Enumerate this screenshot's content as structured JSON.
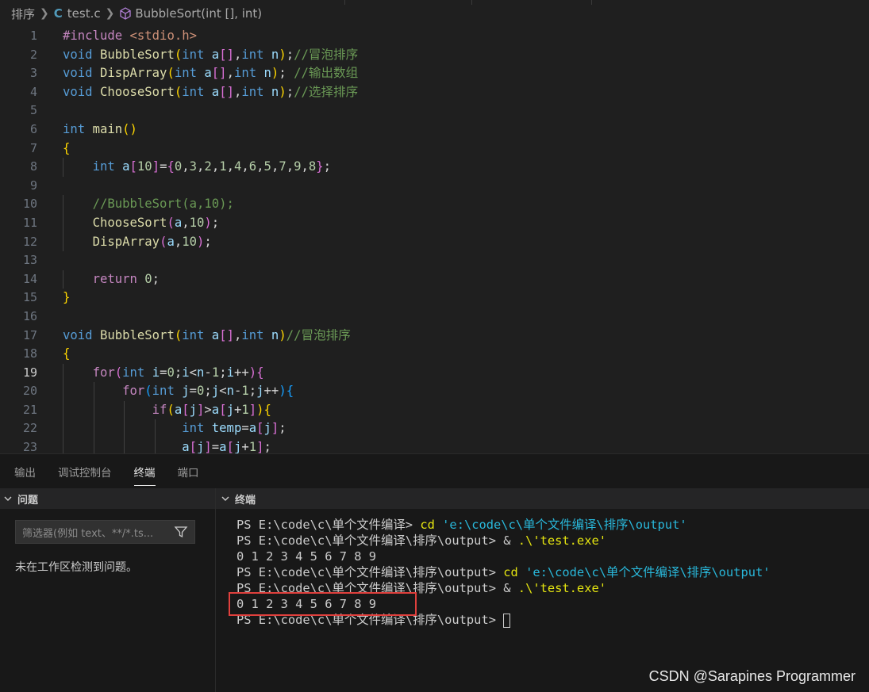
{
  "breadcrumb": {
    "folder": "排序",
    "file_icon": "C",
    "file": "test.c",
    "symbol": "BubbleSort(int [], int)"
  },
  "editor": {
    "active_line": 19,
    "line_numbers": [
      "1",
      "2",
      "3",
      "4",
      "5",
      "6",
      "7",
      "8",
      "9",
      "10",
      "11",
      "12",
      "13",
      "14",
      "15",
      "16",
      "17",
      "18",
      "19",
      "20",
      "21",
      "22",
      "23"
    ],
    "lines": [
      [
        [
          "#include ",
          "pre"
        ],
        [
          "<stdio.h>",
          "str"
        ]
      ],
      [
        [
          "void ",
          "type"
        ],
        [
          "BubbleSort",
          "fn"
        ],
        [
          "(",
          "p1"
        ],
        [
          "int ",
          "type"
        ],
        [
          "a",
          "id"
        ],
        [
          "[]",
          "p2"
        ],
        [
          ",",
          "txt"
        ],
        [
          "int ",
          "type"
        ],
        [
          "n",
          "id"
        ],
        [
          ")",
          "p1"
        ],
        [
          ";",
          "txt"
        ],
        [
          "//冒泡排序",
          "cm"
        ]
      ],
      [
        [
          "void ",
          "type"
        ],
        [
          "DispArray",
          "fn"
        ],
        [
          "(",
          "p1"
        ],
        [
          "int ",
          "type"
        ],
        [
          "a",
          "id"
        ],
        [
          "[]",
          "p2"
        ],
        [
          ",",
          "txt"
        ],
        [
          "int ",
          "type"
        ],
        [
          "n",
          "id"
        ],
        [
          ")",
          "p1"
        ],
        [
          "; ",
          "txt"
        ],
        [
          "//输出数组",
          "cm"
        ]
      ],
      [
        [
          "void ",
          "type"
        ],
        [
          "ChooseSort",
          "fn"
        ],
        [
          "(",
          "p1"
        ],
        [
          "int ",
          "type"
        ],
        [
          "a",
          "id"
        ],
        [
          "[]",
          "p2"
        ],
        [
          ",",
          "txt"
        ],
        [
          "int ",
          "type"
        ],
        [
          "n",
          "id"
        ],
        [
          ")",
          "p1"
        ],
        [
          ";",
          "txt"
        ],
        [
          "//选择排序",
          "cm"
        ]
      ],
      [],
      [
        [
          "int ",
          "type"
        ],
        [
          "main",
          "fn"
        ],
        [
          "()",
          "p1"
        ]
      ],
      [
        [
          "{",
          "p1"
        ]
      ],
      [
        [
          "    ",
          "txt"
        ],
        [
          "int ",
          "type"
        ],
        [
          "a",
          "id"
        ],
        [
          "[",
          "p2"
        ],
        [
          "10",
          "num"
        ],
        [
          "]",
          "p2"
        ],
        [
          "=",
          "txt"
        ],
        [
          "{",
          "p2"
        ],
        [
          "0",
          "num"
        ],
        [
          ",",
          "txt"
        ],
        [
          "3",
          "num"
        ],
        [
          ",",
          "txt"
        ],
        [
          "2",
          "num"
        ],
        [
          ",",
          "txt"
        ],
        [
          "1",
          "num"
        ],
        [
          ",",
          "txt"
        ],
        [
          "4",
          "num"
        ],
        [
          ",",
          "txt"
        ],
        [
          "6",
          "num"
        ],
        [
          ",",
          "txt"
        ],
        [
          "5",
          "num"
        ],
        [
          ",",
          "txt"
        ],
        [
          "7",
          "num"
        ],
        [
          ",",
          "txt"
        ],
        [
          "9",
          "num"
        ],
        [
          ",",
          "txt"
        ],
        [
          "8",
          "num"
        ],
        [
          "}",
          "p2"
        ],
        [
          ";",
          "txt"
        ]
      ],
      [],
      [
        [
          "    ",
          "txt"
        ],
        [
          "//BubbleSort(a,10);",
          "cm"
        ]
      ],
      [
        [
          "    ",
          "txt"
        ],
        [
          "ChooseSort",
          "fn"
        ],
        [
          "(",
          "p2"
        ],
        [
          "a",
          "id"
        ],
        [
          ",",
          "txt"
        ],
        [
          "10",
          "num"
        ],
        [
          ")",
          "p2"
        ],
        [
          ";",
          "txt"
        ]
      ],
      [
        [
          "    ",
          "txt"
        ],
        [
          "DispArray",
          "fn"
        ],
        [
          "(",
          "p2"
        ],
        [
          "a",
          "id"
        ],
        [
          ",",
          "txt"
        ],
        [
          "10",
          "num"
        ],
        [
          ")",
          "p2"
        ],
        [
          ";",
          "txt"
        ]
      ],
      [],
      [
        [
          "    ",
          "txt"
        ],
        [
          "return ",
          "ctl"
        ],
        [
          "0",
          "num"
        ],
        [
          ";",
          "txt"
        ]
      ],
      [
        [
          "}",
          "p1"
        ]
      ],
      [],
      [
        [
          "void ",
          "type"
        ],
        [
          "BubbleSort",
          "fn"
        ],
        [
          "(",
          "p1"
        ],
        [
          "int ",
          "type"
        ],
        [
          "a",
          "id"
        ],
        [
          "[]",
          "p2"
        ],
        [
          ",",
          "txt"
        ],
        [
          "int ",
          "type"
        ],
        [
          "n",
          "id"
        ],
        [
          ")",
          "p1"
        ],
        [
          "//冒泡排序",
          "cm"
        ]
      ],
      [
        [
          "{",
          "p1"
        ]
      ],
      [
        [
          "    ",
          "txt"
        ],
        [
          "for",
          "ctl"
        ],
        [
          "(",
          "p2"
        ],
        [
          "int ",
          "type"
        ],
        [
          "i",
          "id"
        ],
        [
          "=",
          "txt"
        ],
        [
          "0",
          "num"
        ],
        [
          ";",
          "txt"
        ],
        [
          "i",
          "id"
        ],
        [
          "<",
          "txt"
        ],
        [
          "n",
          "id"
        ],
        [
          "-",
          "txt"
        ],
        [
          "1",
          "num"
        ],
        [
          ";",
          "txt"
        ],
        [
          "i",
          "id"
        ],
        [
          "++",
          "txt"
        ],
        [
          ")",
          "p2"
        ],
        [
          "{",
          "p2"
        ]
      ],
      [
        [
          "        ",
          "txt"
        ],
        [
          "for",
          "ctl"
        ],
        [
          "(",
          "p3"
        ],
        [
          "int ",
          "type"
        ],
        [
          "j",
          "id"
        ],
        [
          "=",
          "txt"
        ],
        [
          "0",
          "num"
        ],
        [
          ";",
          "txt"
        ],
        [
          "j",
          "id"
        ],
        [
          "<",
          "txt"
        ],
        [
          "n",
          "id"
        ],
        [
          "-",
          "txt"
        ],
        [
          "1",
          "num"
        ],
        [
          ";",
          "txt"
        ],
        [
          "j",
          "id"
        ],
        [
          "++",
          "txt"
        ],
        [
          ")",
          "p3"
        ],
        [
          "{",
          "p3"
        ]
      ],
      [
        [
          "            ",
          "txt"
        ],
        [
          "if",
          "ctl"
        ],
        [
          "(",
          "p1"
        ],
        [
          "a",
          "id"
        ],
        [
          "[",
          "p2"
        ],
        [
          "j",
          "id"
        ],
        [
          "]",
          "p2"
        ],
        [
          ">",
          "txt"
        ],
        [
          "a",
          "id"
        ],
        [
          "[",
          "p2"
        ],
        [
          "j",
          "id"
        ],
        [
          "+",
          "txt"
        ],
        [
          "1",
          "num"
        ],
        [
          "]",
          "p2"
        ],
        [
          ")",
          "p1"
        ],
        [
          "{",
          "p1"
        ]
      ],
      [
        [
          "                ",
          "txt"
        ],
        [
          "int ",
          "type"
        ],
        [
          "temp",
          "id"
        ],
        [
          "=",
          "txt"
        ],
        [
          "a",
          "id"
        ],
        [
          "[",
          "p2"
        ],
        [
          "j",
          "id"
        ],
        [
          "]",
          "p2"
        ],
        [
          ";",
          "txt"
        ]
      ],
      [
        [
          "                ",
          "txt"
        ],
        [
          "a",
          "id"
        ],
        [
          "[",
          "p2"
        ],
        [
          "j",
          "id"
        ],
        [
          "]",
          "p2"
        ],
        [
          "=",
          "txt"
        ],
        [
          "a",
          "id"
        ],
        [
          "[",
          "p2"
        ],
        [
          "j",
          "id"
        ],
        [
          "+",
          "txt"
        ],
        [
          "1",
          "num"
        ],
        [
          "]",
          "p2"
        ],
        [
          ";",
          "txt"
        ]
      ]
    ]
  },
  "panel": {
    "tabs": [
      {
        "label": "输出",
        "active": false
      },
      {
        "label": "调试控制台",
        "active": false
      },
      {
        "label": "终端",
        "active": true
      },
      {
        "label": "端口",
        "active": false
      }
    ]
  },
  "problems": {
    "header": "问题",
    "filter_placeholder": "筛选器(例如 text、**/*.ts...",
    "empty_message": "未在工作区检测到问题。"
  },
  "terminal": {
    "header": "终端",
    "lines": [
      [
        [
          "PS E:\\code\\c\\单个文件编译> ",
          "txt"
        ],
        [
          "cd ",
          "cmd"
        ],
        [
          "'e:\\code\\c\\单个文件编译\\排序\\output'",
          "str"
        ]
      ],
      [
        [
          "PS E:\\code\\c\\单个文件编译\\排序\\output> ",
          "txt"
        ],
        [
          "& ",
          "txt"
        ],
        [
          ".\\'test.exe'",
          "cmd"
        ]
      ],
      [
        [
          "0 1 2 3 4 5 6 7 8 9",
          "txt"
        ]
      ],
      [
        [
          "PS E:\\code\\c\\单个文件编译\\排序\\output> ",
          "txt"
        ],
        [
          "cd ",
          "cmd"
        ],
        [
          "'e:\\code\\c\\单个文件编译\\排序\\output'",
          "str"
        ]
      ],
      [
        [
          "PS E:\\code\\c\\单个文件编译\\排序\\output> ",
          "txt"
        ],
        [
          "& ",
          "txt"
        ],
        [
          ".\\'test.exe'",
          "cmd"
        ]
      ],
      [
        [
          "0 1 2 3 4 5 6 7 8 9",
          "txt"
        ]
      ],
      [
        [
          "PS E:\\code\\c\\单个文件编译\\排序\\output> ",
          "txt"
        ]
      ]
    ]
  },
  "watermark": "CSDN @Sarapines Programmer",
  "colors": {
    "background": "#1f1f1f",
    "panel_background": "#181818",
    "highlight_box": "#e0403d"
  }
}
